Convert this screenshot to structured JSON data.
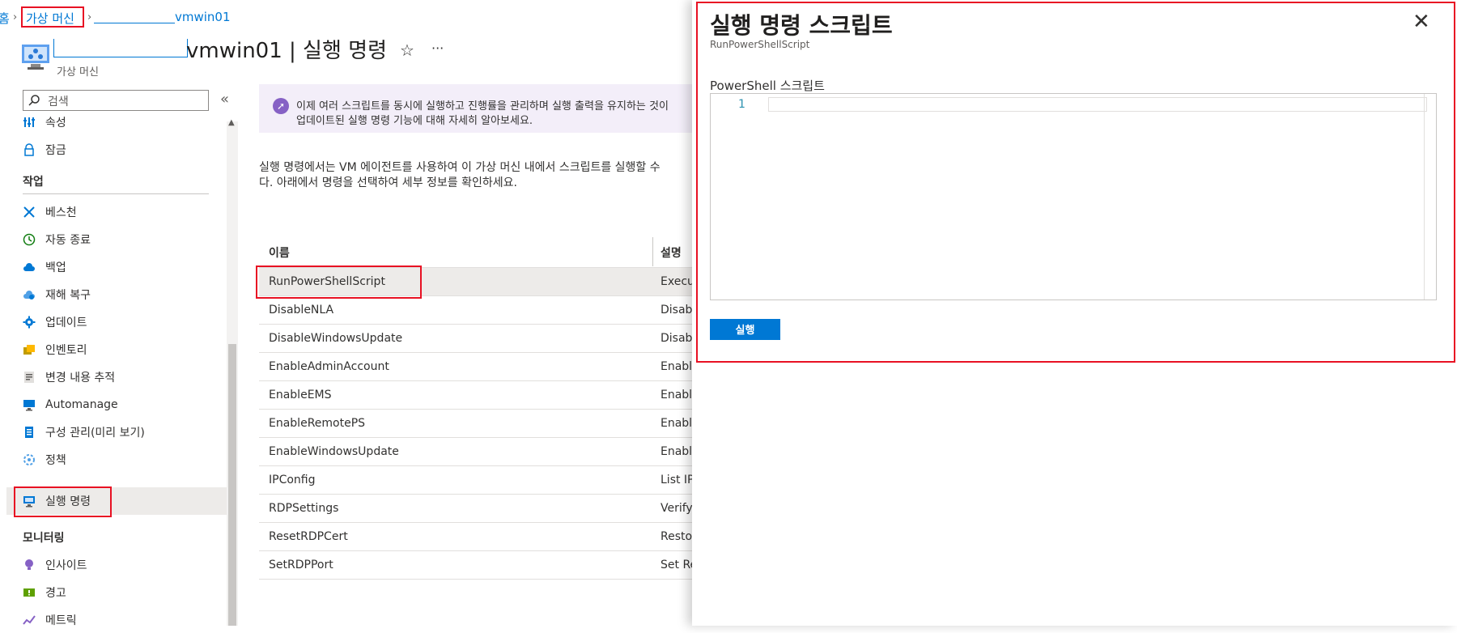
{
  "breadcrumb": {
    "home_fragment": "홈",
    "vms": "가상 머신",
    "vm": "vmwin01"
  },
  "header": {
    "title": "vmwin01 | 실행 명령",
    "subtitle": "가상 머신",
    "star": "☆",
    "more": "···"
  },
  "sidebar": {
    "search_placeholder": "검색",
    "collapse": "«",
    "items_top": [
      {
        "label": "속성",
        "icon": "properties-icon"
      },
      {
        "label": "잠금",
        "icon": "lock-icon"
      }
    ],
    "section_ops": "작업",
    "items_ops": [
      {
        "label": "베스천",
        "icon": "bastion-icon"
      },
      {
        "label": "자동 종료",
        "icon": "clock-icon"
      },
      {
        "label": "백업",
        "icon": "backup-icon"
      },
      {
        "label": "재해 복구",
        "icon": "disaster-recovery-icon"
      },
      {
        "label": "업데이트",
        "icon": "updates-gear-icon"
      },
      {
        "label": "인벤토리",
        "icon": "inventory-icon"
      },
      {
        "label": "변경 내용 추적",
        "icon": "change-tracking-icon"
      },
      {
        "label": "Automanage",
        "icon": "automanage-icon"
      },
      {
        "label": "구성 관리(미리 보기)",
        "icon": "configuration-icon"
      },
      {
        "label": "정책",
        "icon": "policy-icon"
      },
      {
        "label": "실행 명령",
        "icon": "run-command-icon"
      }
    ],
    "section_monitor": "모니터링",
    "items_monitor": [
      {
        "label": "인사이트",
        "icon": "insights-icon"
      },
      {
        "label": "경고",
        "icon": "alerts-icon"
      },
      {
        "label": "메트릭",
        "icon": "metrics-icon"
      }
    ]
  },
  "content": {
    "banner_line1": "이제 여러 스크립트를 동시에 실행하고 진행률을 관리하며 실행 출력을 유지하는 것이",
    "banner_line2": "업데이트된 실행 명령 기능에 대해 자세히 알아보세요.",
    "desc_line1": "실행 명령에서는 VM 에이전트를 사용하여 이 가상 머신 내에서 스크립트를 실행할 수",
    "desc_line2": "다. 아래에서 명령을 선택하여 세부 정보를 확인하세요.",
    "col_name": "이름",
    "col_desc": "설명",
    "rows": [
      {
        "name": "RunPowerShellScript",
        "desc": "Execu"
      },
      {
        "name": "DisableNLA",
        "desc": "Disab"
      },
      {
        "name": "DisableWindowsUpdate",
        "desc": "Disab"
      },
      {
        "name": "EnableAdminAccount",
        "desc": "Enable"
      },
      {
        "name": "EnableEMS",
        "desc": "Enable"
      },
      {
        "name": "EnableRemotePS",
        "desc": "Enable"
      },
      {
        "name": "EnableWindowsUpdate",
        "desc": "Enable"
      },
      {
        "name": "IPConfig",
        "desc": "List IP"
      },
      {
        "name": "RDPSettings",
        "desc": "Verify"
      },
      {
        "name": "ResetRDPCert",
        "desc": "Restor"
      },
      {
        "name": "SetRDPPort",
        "desc": "Set Re"
      }
    ]
  },
  "panel": {
    "title": "실행 명령 스크립트",
    "subtitle": "RunPowerShellScript",
    "close": "✕",
    "script_label": "PowerShell 스크립트",
    "line_number": "1",
    "run_button": "실행"
  }
}
